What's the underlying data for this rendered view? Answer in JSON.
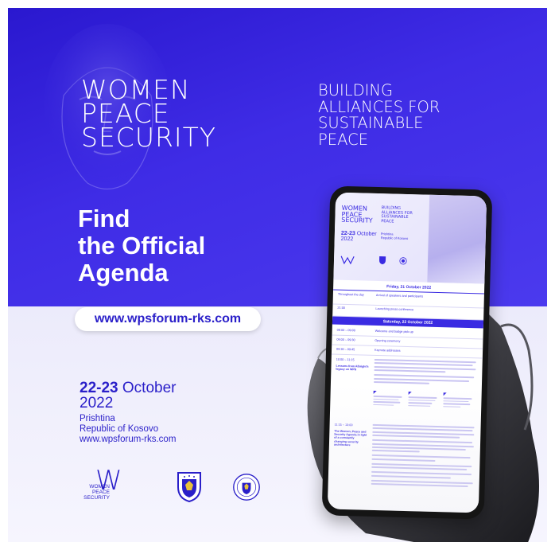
{
  "poster": {
    "title_lines": [
      "WOMEN",
      "PEACE",
      "SECURITY"
    ],
    "tagline_lines": [
      "BUILDING",
      "ALLIANCES FOR",
      "SUSTAINABLE",
      "PEACE"
    ],
    "cta_lines": [
      "Find",
      "the Official",
      "Agenda"
    ],
    "url_button": "www.wpsforum-rks.com",
    "date_bold": "22-23",
    "date_month": "October",
    "date_year": "2022",
    "location_lines": [
      "Prishtina",
      "Republic of Kosovo",
      "www.wpsforum-rks.com"
    ],
    "logo_letter": "W",
    "logo_text_lines": [
      "WOMEN",
      "PEACE",
      "SECURITY"
    ],
    "colors": {
      "primary": "#3a2be2",
      "dark_primary": "#2a1fc9",
      "pale": "#eceafb"
    }
  },
  "phone_screen": {
    "title_lines": [
      "WOMEN",
      "PEACE",
      "SECURITY"
    ],
    "tagline_lines": [
      "BUILDING",
      "ALLIANCES FOR",
      "SUSTAINABLE",
      "PEACE"
    ],
    "date_bold": "22-23",
    "date_month": "October",
    "date_year": "2022",
    "location_lines": [
      "Prishtina",
      "Republic of Kosovo"
    ],
    "friday_header": "Friday, 21 October 2022",
    "friday_rows": [
      {
        "time": "Throughout the day",
        "item": "Arrival of speakers and participants"
      },
      {
        "time": "21:00",
        "item": "Launching press conference"
      }
    ],
    "saturday_header": "Saturday, 22 October 2022",
    "saturday_rows": [
      {
        "time": "08:00 – 09:00",
        "item": "Welcome and badge pick-up"
      },
      {
        "time": "09:00 – 09:30",
        "item": "Opening ceremony"
      },
      {
        "time": "09:30 – 09:45",
        "item": "Keynote addresses"
      }
    ],
    "session1": {
      "time": "10:00 – 11:15",
      "label": "Lessons from Albright's legacy on WPS"
    },
    "session2": {
      "time": "11:15 – 13:00",
      "label": "The Women, Peace and Security Agenda in light of a constantly changing security architecture"
    }
  }
}
